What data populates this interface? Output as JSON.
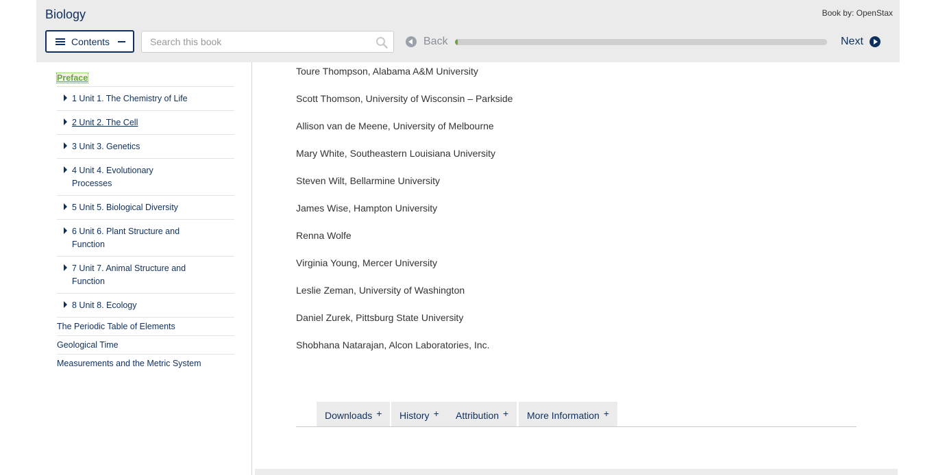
{
  "header": {
    "book_title": "Biology",
    "book_by": "Book by: OpenStax",
    "contents_label": "Contents",
    "search_placeholder": "Search this book",
    "back_label": "Back",
    "next_label": "Next",
    "progress_fraction": 0.005
  },
  "toc": {
    "preface": "Preface",
    "units": [
      {
        "label": "1 Unit 1. The Chemistry of Life"
      },
      {
        "label": "2 Unit 2. The Cell"
      },
      {
        "label": "3 Unit 3. Genetics"
      },
      {
        "label": "4 Unit 4. Evolutionary Processes"
      },
      {
        "label": "5 Unit 5. Biological Diversity"
      },
      {
        "label": "6 Unit 6. Plant Structure and Function"
      },
      {
        "label": "7 Unit 7. Animal Structure and Function"
      },
      {
        "label": "8 Unit 8. Ecology"
      }
    ],
    "appendices": [
      "The Periodic Table of Elements",
      "Geological Time",
      "Measurements and the Metric System"
    ]
  },
  "main": {
    "reviewers": [
      "Toure Thompson, Alabama A&M University",
      "Scott Thomson, University of Wisconsin – Parkside",
      "Allison van de Meene, University of Melbourne",
      "Mary White, Southeastern Louisiana University",
      "Steven Wilt, Bellarmine University",
      "James Wise, Hampton University",
      "Renna Wolfe",
      "Virginia Young, Mercer University",
      "Leslie Zeman, University of Washington",
      "Daniel Zurek, Pittsburg State University",
      "Shobhana Natarajan, Alcon Laboratories, Inc."
    ],
    "tabs": [
      "Downloads",
      "History",
      "Attribution",
      "More Information"
    ],
    "tab_plus": "+"
  },
  "colors": {
    "brand_navy": "#0f2f5c",
    "accent_green": "#6ba442",
    "toolbar_gray": "#ebebeb"
  },
  "icons": {
    "contents": "list-icon",
    "collapse": "minus-icon",
    "search": "search-icon",
    "back": "circle-arrow-left-icon",
    "next": "circle-arrow-right-icon",
    "toc_expand": "caret-right-icon"
  }
}
